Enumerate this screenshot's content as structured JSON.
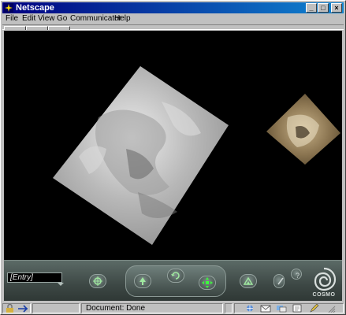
{
  "window": {
    "title": "Netscape",
    "controls": {
      "minimize": "_",
      "maximize": "□",
      "close": "×"
    }
  },
  "menu": [
    {
      "label": "File"
    },
    {
      "label": "Edit"
    },
    {
      "label": "View"
    },
    {
      "label": "Go"
    },
    {
      "label": "Communicator"
    },
    {
      "label": "Help"
    }
  ],
  "viewer": {
    "plugin": "COSMO",
    "viewpoint": "[Entry]",
    "icons": [
      "target-icon",
      "walk-icon",
      "rotate-icon",
      "pan-icon",
      "tilt-icon",
      "seek-icon",
      "help-icon"
    ]
  },
  "status": {
    "text": "Document: Done",
    "icons": [
      "security-lock-icon",
      "component-bar-icon",
      "network-icon",
      "mail-icon",
      "discussion-icon",
      "composer-icon",
      "edit-icon"
    ]
  }
}
